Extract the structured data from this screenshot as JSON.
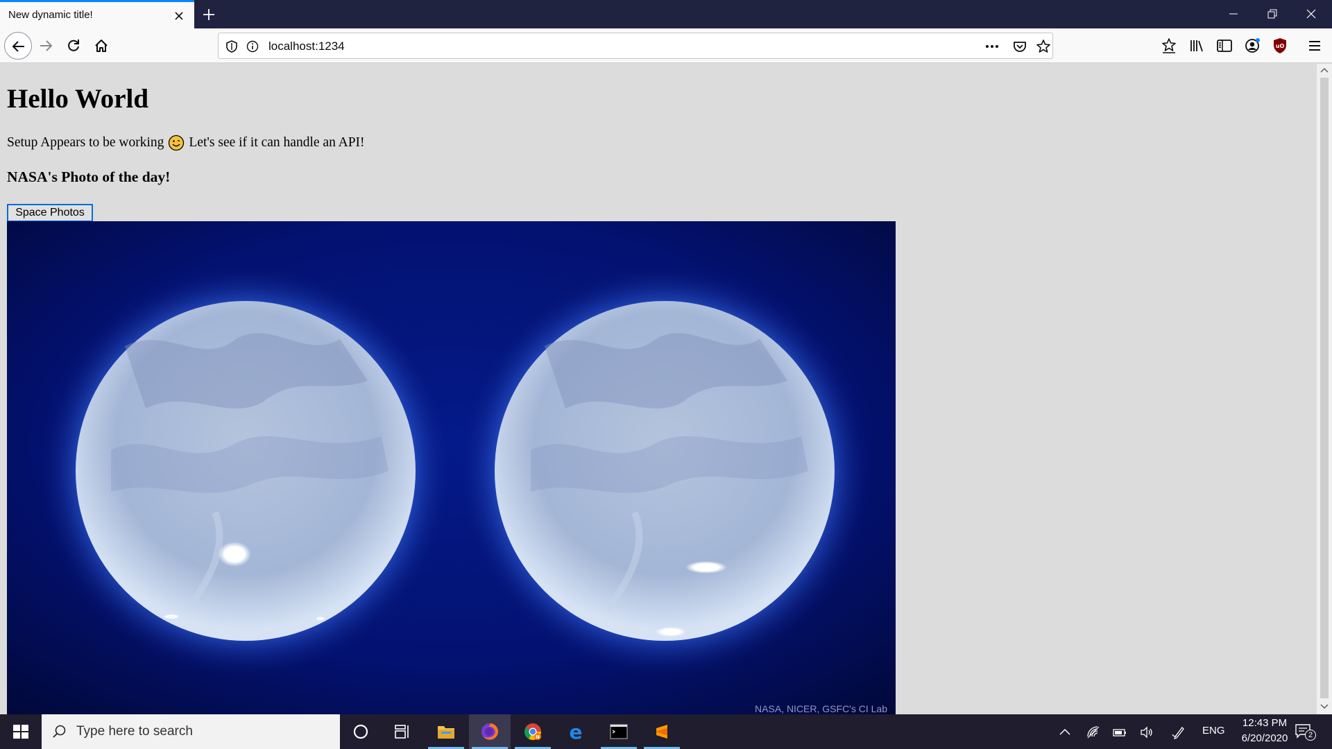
{
  "browser": {
    "tab_title": "New dynamic title!",
    "url": "localhost:1234",
    "accent_color": "#0a84ff"
  },
  "page": {
    "heading": "Hello World",
    "intro_before": "Setup Appears to be working",
    "intro_emoji_icon": "smiling-face-icon",
    "intro_after": "Let's see if it can handle an API!",
    "subheading": "NASA's Photo of the day!",
    "button_label": "Space Photos",
    "image_credit": "NASA, NICER, GSFC's CI Lab"
  },
  "taskbar": {
    "search_placeholder": "Type here to search",
    "language": "ENG",
    "time": "12:43 PM",
    "date": "6/20/2020",
    "notification_count": "2",
    "apps": [
      "file-explorer-icon",
      "firefox-icon",
      "chrome-icon",
      "edge-icon",
      "terminal-icon",
      "sublime-text-icon"
    ]
  }
}
